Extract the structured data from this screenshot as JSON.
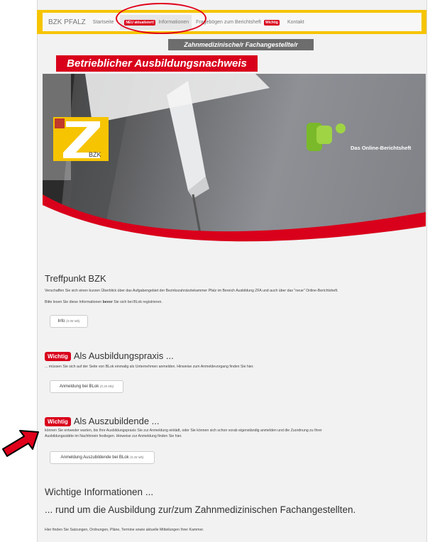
{
  "nav": {
    "brand": "BZK PFALZ",
    "home": "Startseite",
    "info_badge": "NEU aktualisiert!",
    "info": "Informationen",
    "questionnaire": "Fragebögen zum Berichtsheft",
    "questionnaire_badge": "Wichtig",
    "contact": "Kontakt"
  },
  "header": {
    "subtitle": "Zahnmedizinische/r Fachangestellte/r",
    "title": "Betrieblicher Ausbildungsnachweis"
  },
  "hero": {
    "bzk_logo_text": "BZK",
    "blok_logo_text": "Das Online-Berichtsheft"
  },
  "treffpunkt": {
    "heading": "Treffpunkt BZK",
    "line1": "Verschaffen Sie sich einen kurzen Überblick über das Aufgabengebiet der Bezirkszahnärztekammer Pfalz im Bereich Ausbildung ZFA und auch über das \"neue\" Online-Berichtsheft.",
    "line2_pre": "Bitte lesen Sie diese Informationen ",
    "line2_bold": "bevor",
    "line2_post": " Sie sich bei BLok registrieren.",
    "button": "Info",
    "button_size": "(0.08 Mb)"
  },
  "praxis": {
    "badge": "Wichtig",
    "heading": "Als Ausbildungspraxis ...",
    "text": "... müssen Sie sich auf der Seite von BLok einmalig als Unternehmen anmelden. Hinweise zum Anmeldevorgang finden Sie hier.",
    "button": "Anmeldung bei BLok",
    "button_size": "(0.35 Mb)"
  },
  "azubi": {
    "badge": "Wichtig",
    "heading": "Als Auszubildende ...",
    "line1": "können Sie entweder warten, bis Ihre Ausbildungspraxis Sie zur Anmeldung einlädt, oder Sie können sich schon vorab eigenständig anmelden und die Zuordnung zu Ihrer",
    "line2": "Ausbildungsstätte im Nachhinein festlegen. Hinweise zur Anmeldung finden Sie hier.",
    "button": "Anmeldung Auszubildende bei BLok",
    "button_size": "(0.28 Mb)"
  },
  "wichtige": {
    "heading": "Wichtige Informationen ...",
    "subheading": "... rund um die Ausbildung zur/zum Zahnmedizinischen Fachangestellten.",
    "text": "Hier finden Sie Satzungen, Ordnungen, Pläne, Termine sowie aktuelle Mitteilungen Ihrer Kammer."
  },
  "colors": {
    "accent_red": "#d9001b",
    "frame_yellow": "#f6c400",
    "blok_green": "#7ab929"
  }
}
